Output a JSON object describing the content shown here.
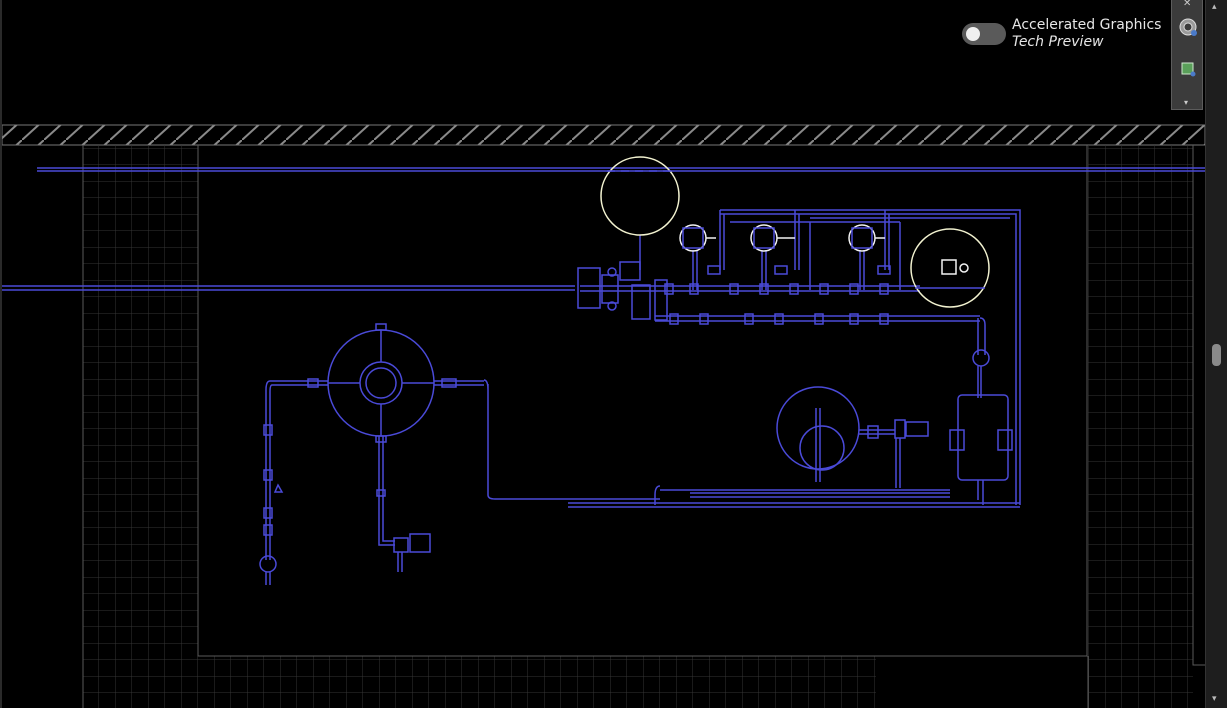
{
  "accelerated_graphics": {
    "label": "Accelerated Graphics",
    "sublabel": "Tech Preview",
    "enabled": false
  },
  "navbar": {
    "icons": [
      "steering-wheel-icon",
      "view-cube-icon"
    ]
  },
  "colors": {
    "background": "#000000",
    "pipe": "#4a4ad8",
    "grid": "#3a3a3a",
    "highlight": "#f2f2d0"
  }
}
